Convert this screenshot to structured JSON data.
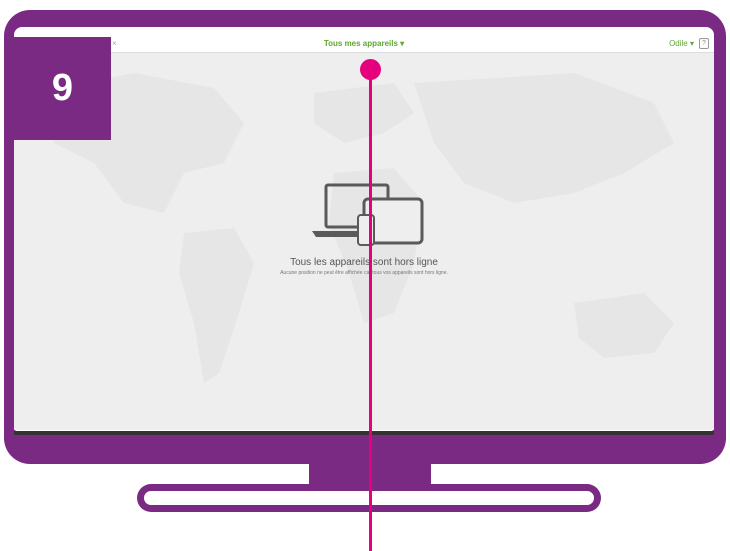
{
  "step": {
    "number": "9"
  },
  "app": {
    "close_symbol": "×",
    "title": "Tous mes appareils ▾",
    "user_menu": "Odile ▾",
    "help_symbol": "?"
  },
  "empty_state": {
    "icon": "devices-icon",
    "title": "Tous les appareils sont hors ligne",
    "subtitle": "Aucune position ne peut être affichée car tous vos appareils sont hors ligne."
  },
  "colors": {
    "frame": "#7a2a82",
    "pointer": "#e6007e",
    "accent_green": "#5fa832",
    "map_bg": "#eeeeee"
  }
}
